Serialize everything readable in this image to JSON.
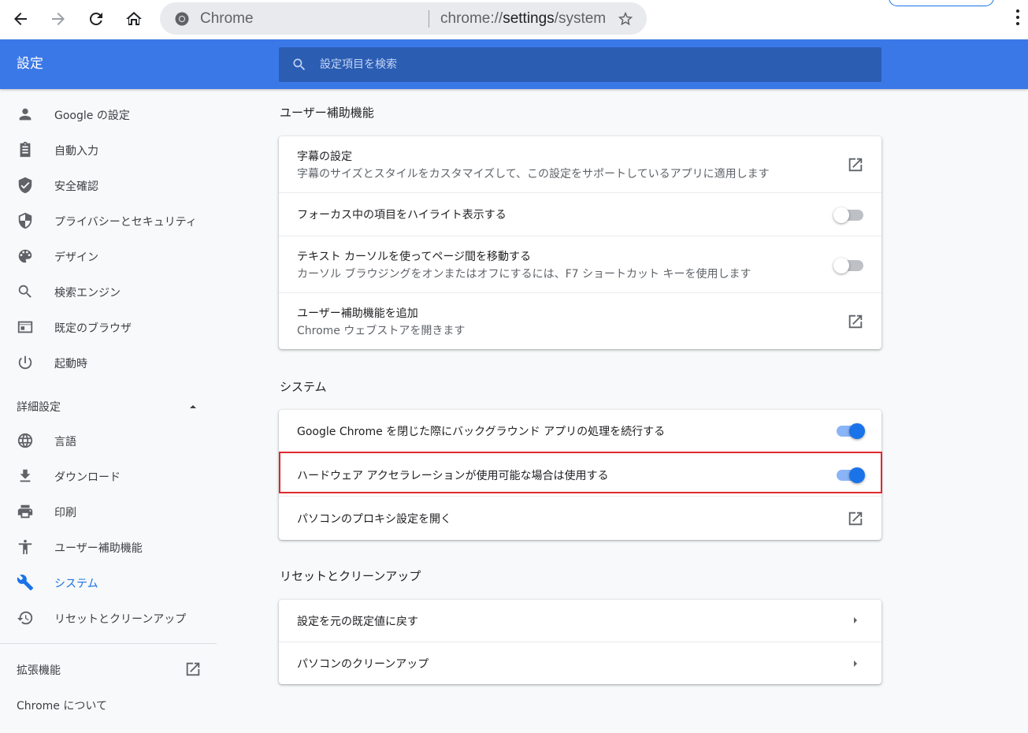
{
  "browser": {
    "site_name": "Chrome",
    "url_prefix": "chrome://",
    "url_main": "settings",
    "url_suffix": "/system"
  },
  "header": {
    "title": "設定",
    "search_placeholder": "設定項目を検索"
  },
  "sidebar": {
    "items": [
      {
        "label": "Google の設定",
        "icon": "person-icon"
      },
      {
        "label": "自動入力",
        "icon": "clipboard-icon"
      },
      {
        "label": "安全確認",
        "icon": "shield-check-icon"
      },
      {
        "label": "プライバシーとセキュリティ",
        "icon": "shield-half-icon"
      },
      {
        "label": "デザイン",
        "icon": "palette-icon"
      },
      {
        "label": "検索エンジン",
        "icon": "search-icon"
      },
      {
        "label": "既定のブラウザ",
        "icon": "browser-window-icon"
      },
      {
        "label": "起動時",
        "icon": "power-icon"
      }
    ],
    "advanced_label": "詳細設定",
    "advanced_items": [
      {
        "label": "言語",
        "icon": "globe-icon"
      },
      {
        "label": "ダウンロード",
        "icon": "download-icon"
      },
      {
        "label": "印刷",
        "icon": "printer-icon"
      },
      {
        "label": "ユーザー補助機能",
        "icon": "accessibility-icon"
      },
      {
        "label": "システム",
        "icon": "wrench-icon",
        "active": true
      },
      {
        "label": "リセットとクリーンアップ",
        "icon": "history-icon"
      }
    ],
    "extensions_label": "拡張機能",
    "about_label": "Chrome について"
  },
  "sections": {
    "accessibility": {
      "title": "ユーザー補助機能",
      "rows": [
        {
          "primary": "字幕の設定",
          "secondary": "字幕のサイズとスタイルをカスタマイズして、この設定をサポートしているアプリに適用します",
          "control": "external-link"
        },
        {
          "primary": "フォーカス中の項目をハイライト表示する",
          "control": "toggle",
          "enabled": false
        },
        {
          "primary": "テキスト カーソルを使ってページ間を移動する",
          "secondary": "カーソル ブラウジングをオンまたはオフにするには、F7 ショートカット キーを使用します",
          "control": "toggle",
          "enabled": false
        },
        {
          "primary": "ユーザー補助機能を追加",
          "secondary": "Chrome ウェブストアを開きます",
          "control": "external-link"
        }
      ]
    },
    "system": {
      "title": "システム",
      "rows": [
        {
          "primary": "Google Chrome を閉じた際にバックグラウンド アプリの処理を続行する",
          "control": "toggle",
          "enabled": true
        },
        {
          "primary": "ハードウェア アクセラレーションが使用可能な場合は使用する",
          "control": "toggle",
          "enabled": true,
          "highlighted": true
        },
        {
          "primary": "パソコンのプロキシ設定を開く",
          "control": "external-link"
        }
      ]
    },
    "reset": {
      "title": "リセットとクリーンアップ",
      "rows": [
        {
          "primary": "設定を元の既定値に戻す",
          "control": "arrow"
        },
        {
          "primary": "パソコンのクリーンアップ",
          "control": "arrow"
        }
      ]
    }
  },
  "colors": {
    "header_blue": "#3b78e7",
    "search_blue": "#2b5db3",
    "accent": "#1a73e8",
    "highlight_border": "#e0282e"
  }
}
